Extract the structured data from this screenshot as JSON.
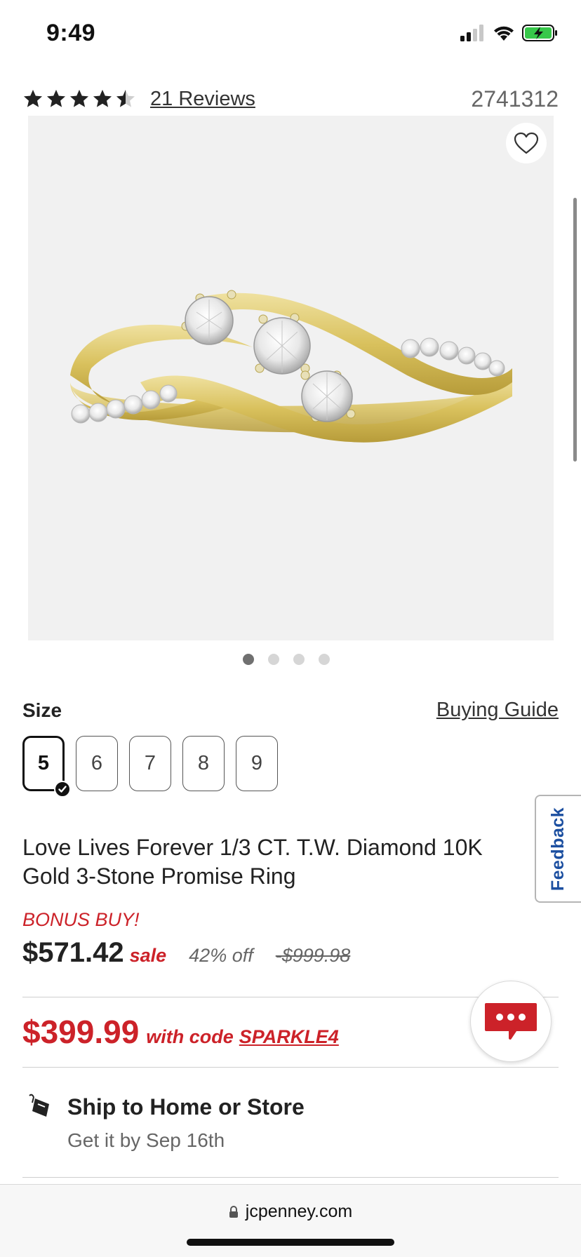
{
  "status_bar": {
    "time": "9:49"
  },
  "rating": {
    "value": 4.5,
    "reviews_label": "21 Reviews",
    "sku": "2741312"
  },
  "image": {
    "slide_count": 4,
    "active_slide": 1
  },
  "size": {
    "label": "Size",
    "guide_label": "Buying Guide",
    "options": [
      "5",
      "6",
      "7",
      "8",
      "9"
    ],
    "selected": "5"
  },
  "feedback_label": "Feedback",
  "product": {
    "title": "Love Lives Forever 1/3 CT. T.W. Diamond 10K Gold 3-Stone Promise Ring"
  },
  "pricing": {
    "badge": "BONUS BUY!",
    "sale_price": "$571.42",
    "sale_label": "sale",
    "discount": "42% off",
    "original_price": "-$999.98",
    "code_price": "$399.99",
    "code_text": "with code",
    "code": "SPARKLE4"
  },
  "shipping": {
    "title": "Ship to Home or Store",
    "subtitle": "Get it by Sep 16th"
  },
  "browser": {
    "url": "jcpenney.com"
  },
  "colors": {
    "accent_red": "#cc2229",
    "feedback_blue": "#1c4fa0",
    "gold": "#d4bd55"
  }
}
